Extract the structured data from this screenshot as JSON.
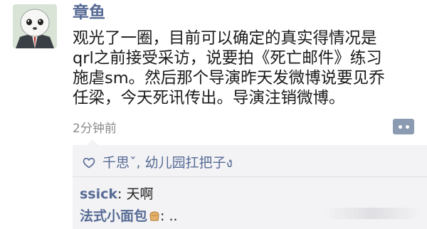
{
  "post": {
    "author": "章鱼",
    "lines": [
      "观光了一圈，目前可以确定的真实得情况是",
      "qrl之前接受采访，说要拍《死亡邮件》练习",
      "施虐sm。然后那个导演昨天发微博说要见乔",
      "任梁，今天死讯传出。导演注销微博。"
    ],
    "time": "2分钟前"
  },
  "likes": {
    "names": "千思ˇ, 幼儿园扛把子ง"
  },
  "comments": [
    {
      "author": "ssick",
      "sep": ": ",
      "text": "天啊"
    },
    {
      "author": "法式小面包",
      "sep": ": ",
      "text": ".."
    }
  ],
  "colors": {
    "name_blue": "#576b95",
    "comment_bg": "#f3f3f5",
    "more_button": "#8a9bb2"
  },
  "icons": {
    "avatar": "cartoon-face-avatar",
    "like": "heart-outline-icon",
    "more": "more-dots-icon",
    "bread": "bread-emoji-icon"
  }
}
